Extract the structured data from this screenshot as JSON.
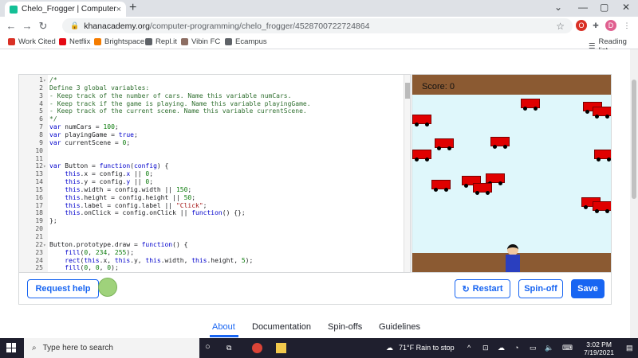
{
  "browser": {
    "tab_title": "Chelo_Frogger | Computer progr...",
    "tab_close": "×",
    "new_tab": "+",
    "url_host": "khanacademy.org",
    "url_path": "/computer-programming/chelo_frogger/4528700722724864",
    "reading_list": "Reading list",
    "profile_initial": "D",
    "bookmarks": [
      {
        "label": "Work Cited",
        "color": "#d93025"
      },
      {
        "label": "Netflix",
        "color": "#e50914"
      },
      {
        "label": "Brightspace",
        "color": "#f57c00"
      },
      {
        "label": "Repl.it",
        "color": "#5f6368"
      },
      {
        "label": "Vibin FC",
        "color": "#8d6e63"
      },
      {
        "label": "Ecampus",
        "color": "#5f6368"
      }
    ]
  },
  "editor": {
    "lines": [
      {
        "n": "1",
        "fold": "▾",
        "html": "<span class='c'>/*</span>"
      },
      {
        "n": "2",
        "fold": "",
        "html": "<span class='c'>Define 3 global variables:</span>"
      },
      {
        "n": "3",
        "fold": "",
        "html": "<span class='c'>- Keep track of the number of cars. Name this variable numCars.</span>"
      },
      {
        "n": "4",
        "fold": "",
        "html": "<span class='c'>- Keep track if the game is playing. Name this variable playingGame.</span>"
      },
      {
        "n": "5",
        "fold": "",
        "html": "<span class='c'>- Keep track of the current scene. Name this variable currentScene.</span>"
      },
      {
        "n": "6",
        "fold": "",
        "html": "<span class='c'>*/</span>"
      },
      {
        "n": "7",
        "fold": "",
        "html": "<span class='k'>var</span> numCars = <span class='n'>100</span>;"
      },
      {
        "n": "8",
        "fold": "",
        "html": "<span class='k'>var</span> playingGame = <span class='k'>true</span>;"
      },
      {
        "n": "9",
        "fold": "",
        "html": "<span class='k'>var</span> currentScene = <span class='n'>0</span>;"
      },
      {
        "n": "10",
        "fold": "",
        "html": ""
      },
      {
        "n": "11",
        "fold": "",
        "html": ""
      },
      {
        "n": "12",
        "fold": "▾",
        "html": "<span class='k'>var</span> Button = <span class='k'>function</span>(<span class='k'>config</span>) {"
      },
      {
        "n": "13",
        "fold": "",
        "html": "    <span class='k'>this</span>.x = config.<span class='k'>x</span> || <span class='n'>0</span>;"
      },
      {
        "n": "14",
        "fold": "",
        "html": "    <span class='k'>this</span>.y = config.<span class='k'>y</span> || <span class='n'>0</span>;"
      },
      {
        "n": "15",
        "fold": "",
        "html": "    <span class='k'>this</span>.width = config.width || <span class='n'>150</span>;"
      },
      {
        "n": "16",
        "fold": "",
        "html": "    <span class='k'>this</span>.height = config.height || <span class='n'>50</span>;"
      },
      {
        "n": "17",
        "fold": "",
        "html": "    <span class='k'>this</span>.label = config.label || <span class='s'>\"Click\"</span>;"
      },
      {
        "n": "18",
        "fold": "",
        "html": "    <span class='k'>this</span>.onClick = config.onClick || <span class='k'>function</span>() {};"
      },
      {
        "n": "19",
        "fold": "",
        "html": "};"
      },
      {
        "n": "20",
        "fold": "",
        "html": ""
      },
      {
        "n": "21",
        "fold": "",
        "html": ""
      },
      {
        "n": "22",
        "fold": "▾",
        "html": "Button.prototype.draw = <span class='k'>function</span>() {"
      },
      {
        "n": "23",
        "fold": "",
        "html": "    <span class='k'>fill</span>(<span class='n'>0</span>, <span class='n'>234</span>, <span class='n'>255</span>);"
      },
      {
        "n": "24",
        "fold": "",
        "html": "    <span class='k'>rect</span>(<span class='k'>this</span>.x, <span class='k'>this</span>.y, <span class='k'>this</span>.width, <span class='k'>this</span>.height, <span class='n'>5</span>);"
      },
      {
        "n": "25",
        "fold": "",
        "html": "    <span class='k'>fill</span>(<span class='n'>0</span>, <span class='n'>0</span>, <span class='n'>0</span>);"
      }
    ]
  },
  "game": {
    "score_text": "Score: 0",
    "car_color": "#e00000",
    "car_count": 17
  },
  "actions": {
    "request_help": "Request help",
    "restart": "Restart",
    "spinoff": "Spin-off",
    "save": "Save"
  },
  "page_tabs": [
    "About",
    "Documentation",
    "Spin-offs",
    "Guidelines"
  ],
  "taskbar": {
    "search_placeholder": "Type here to search",
    "weather": "71°F  Rain to stop",
    "time": "3:02 PM",
    "date": "7/19/2021"
  }
}
